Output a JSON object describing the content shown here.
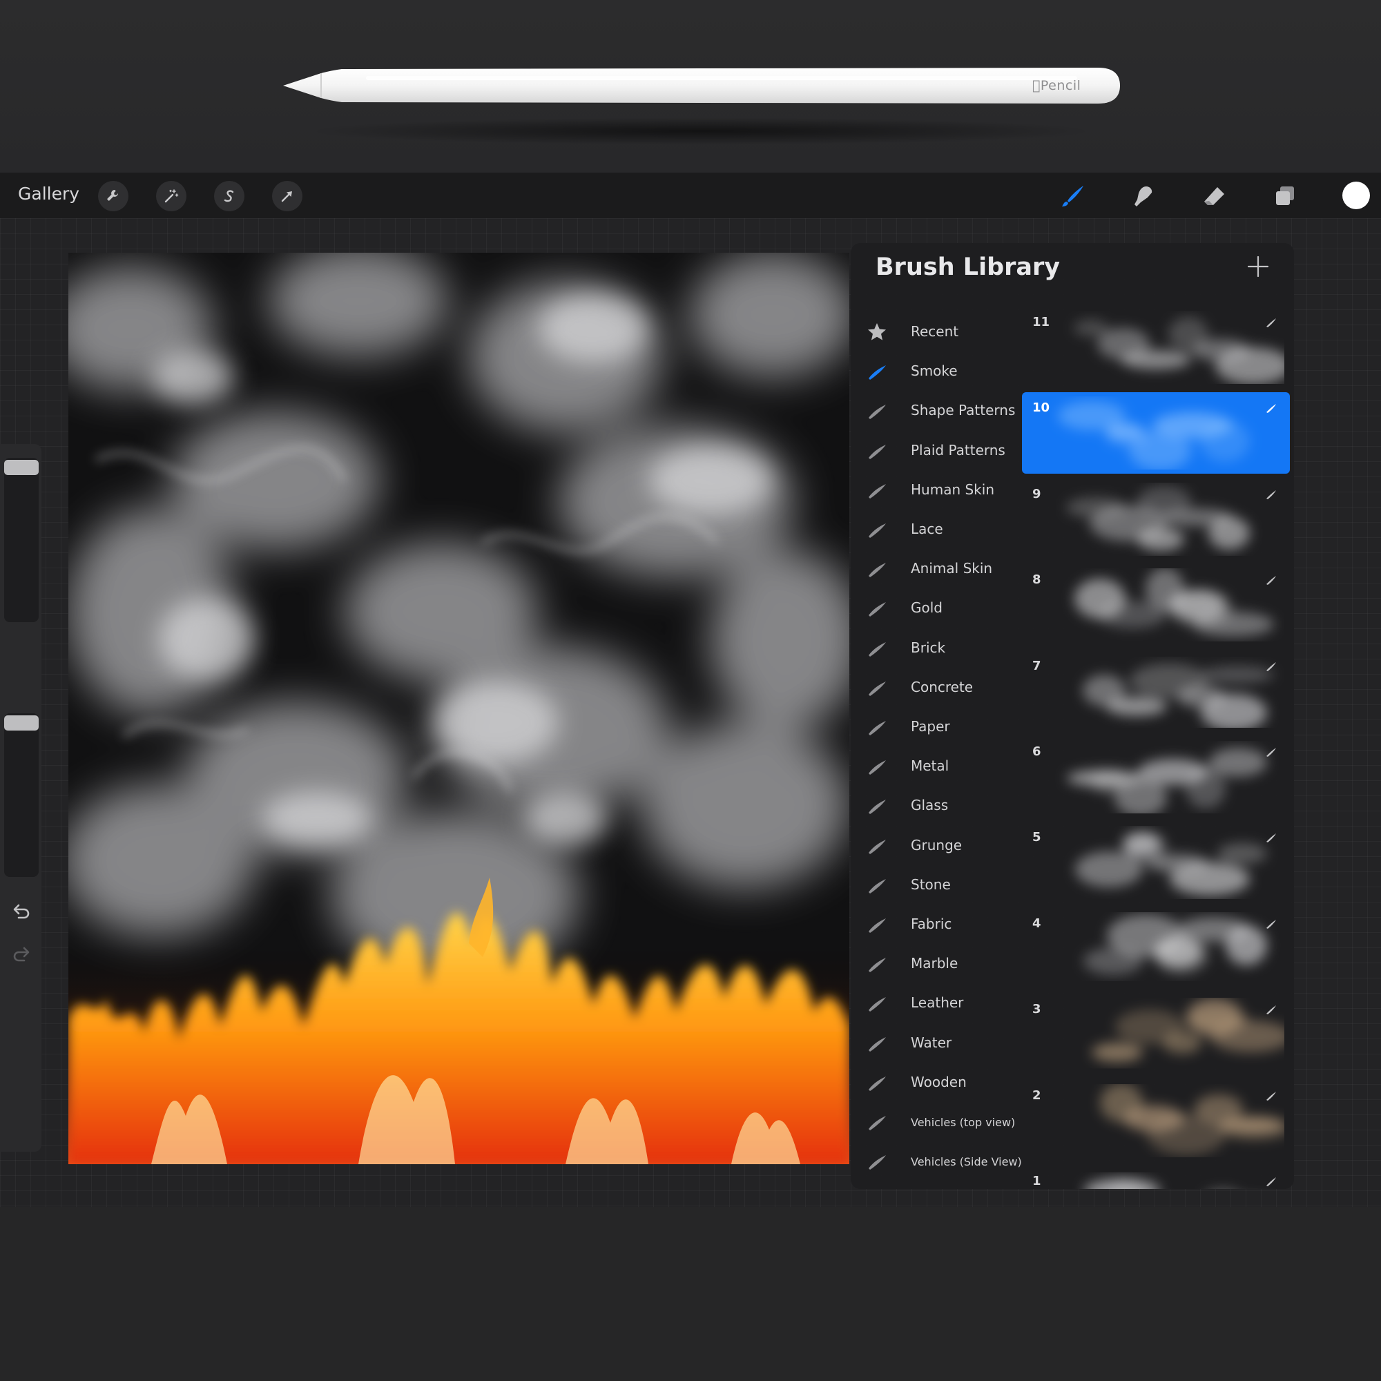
{
  "pencil": {
    "brand": "Pencil"
  },
  "toolbar": {
    "gallery_label": "Gallery",
    "left_tools": [
      "wrench-icon",
      "magic-wand-icon",
      "selection-s-icon",
      "transform-arrow-icon"
    ],
    "right_tools": [
      "brush-icon",
      "smudge-icon",
      "eraser-icon",
      "layers-icon"
    ],
    "active_tool": "brush-icon",
    "active_color": "#ffffff",
    "accent": "#1a7ef6"
  },
  "sidebar": {
    "size_level": 0.0,
    "opacity_level": 0.0
  },
  "brush_library": {
    "title": "Brush Library",
    "add_icon": "plus-icon",
    "brush_sets": [
      {
        "label": "Recent",
        "icon": "star-icon"
      },
      {
        "label": "Smoke",
        "icon": "brush-stroke-icon",
        "selected": true
      },
      {
        "label": "Shape Patterns",
        "icon": "brush-stroke-icon"
      },
      {
        "label": "Plaid Patterns",
        "icon": "brush-stroke-icon"
      },
      {
        "label": "Human Skin",
        "icon": "brush-stroke-icon"
      },
      {
        "label": "Lace",
        "icon": "brush-stroke-icon"
      },
      {
        "label": "Animal Skin",
        "icon": "brush-stroke-icon"
      },
      {
        "label": "Gold",
        "icon": "brush-stroke-icon"
      },
      {
        "label": "Brick",
        "icon": "brush-stroke-icon"
      },
      {
        "label": "Concrete",
        "icon": "brush-stroke-icon"
      },
      {
        "label": "Paper",
        "icon": "brush-stroke-icon"
      },
      {
        "label": "Metal",
        "icon": "brush-stroke-icon"
      },
      {
        "label": "Glass",
        "icon": "brush-stroke-icon"
      },
      {
        "label": "Grunge",
        "icon": "brush-stroke-icon"
      },
      {
        "label": "Stone",
        "icon": "brush-stroke-icon"
      },
      {
        "label": "Fabric",
        "icon": "brush-stroke-icon"
      },
      {
        "label": "Marble",
        "icon": "brush-stroke-icon"
      },
      {
        "label": "Leather",
        "icon": "brush-stroke-icon"
      },
      {
        "label": "Water",
        "icon": "brush-stroke-icon"
      },
      {
        "label": "Wooden",
        "icon": "brush-stroke-icon"
      },
      {
        "label": "Vehicles (top view)",
        "icon": "brush-stroke-icon"
      },
      {
        "label": "Vehicles (Side View)",
        "icon": "brush-stroke-icon"
      }
    ],
    "brushes": [
      {
        "number": "11"
      },
      {
        "number": "10",
        "selected": true
      },
      {
        "number": "9"
      },
      {
        "number": "8"
      },
      {
        "number": "7"
      },
      {
        "number": "6"
      },
      {
        "number": "5"
      },
      {
        "number": "4"
      },
      {
        "number": "3"
      },
      {
        "number": "2"
      },
      {
        "number": "1"
      }
    ]
  }
}
